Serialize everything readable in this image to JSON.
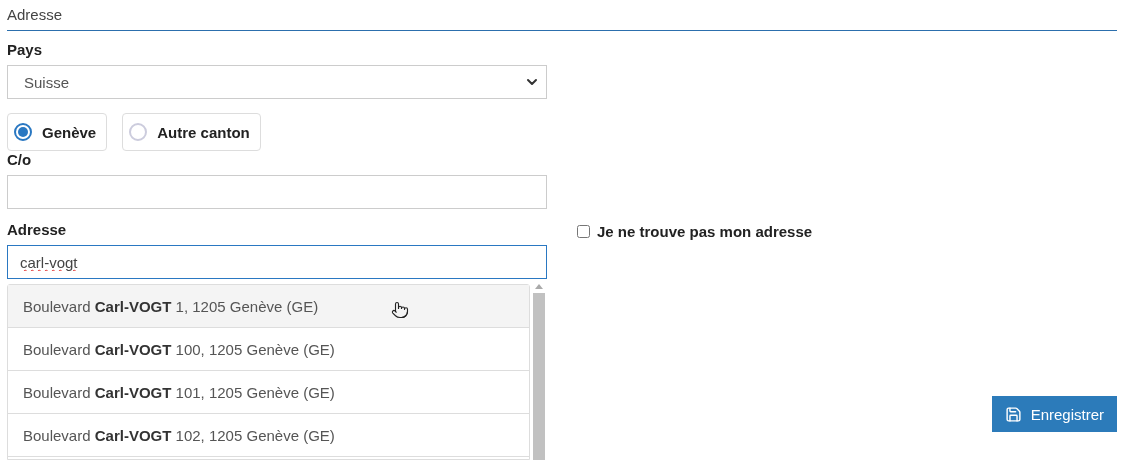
{
  "section_title": "Adresse",
  "country": {
    "label": "Pays",
    "value": "Suisse"
  },
  "canton_options": [
    {
      "label": "Genève",
      "selected": true
    },
    {
      "label": "Autre canton",
      "selected": false
    }
  ],
  "care_of": {
    "label": "C/o"
  },
  "address": {
    "label": "Adresse",
    "value": "carl-vogt",
    "suggestions": [
      {
        "text": "Boulevard **Carl-VOGT** 1, 1205 Genève (GE)",
        "highlighted": true
      },
      {
        "text": "Boulevard **Carl-VOGT** 100, 1205 Genève (GE)",
        "highlighted": false
      },
      {
        "text": "Boulevard **Carl-VOGT** 101, 1205 Genève (GE)",
        "highlighted": false
      },
      {
        "text": "Boulevard **Carl-VOGT** 102, 1205 Genève (GE)",
        "highlighted": false
      }
    ]
  },
  "not_found": {
    "label": "Je ne trouve pas mon adresse",
    "checked": false
  },
  "save_button": "Enregistrer"
}
